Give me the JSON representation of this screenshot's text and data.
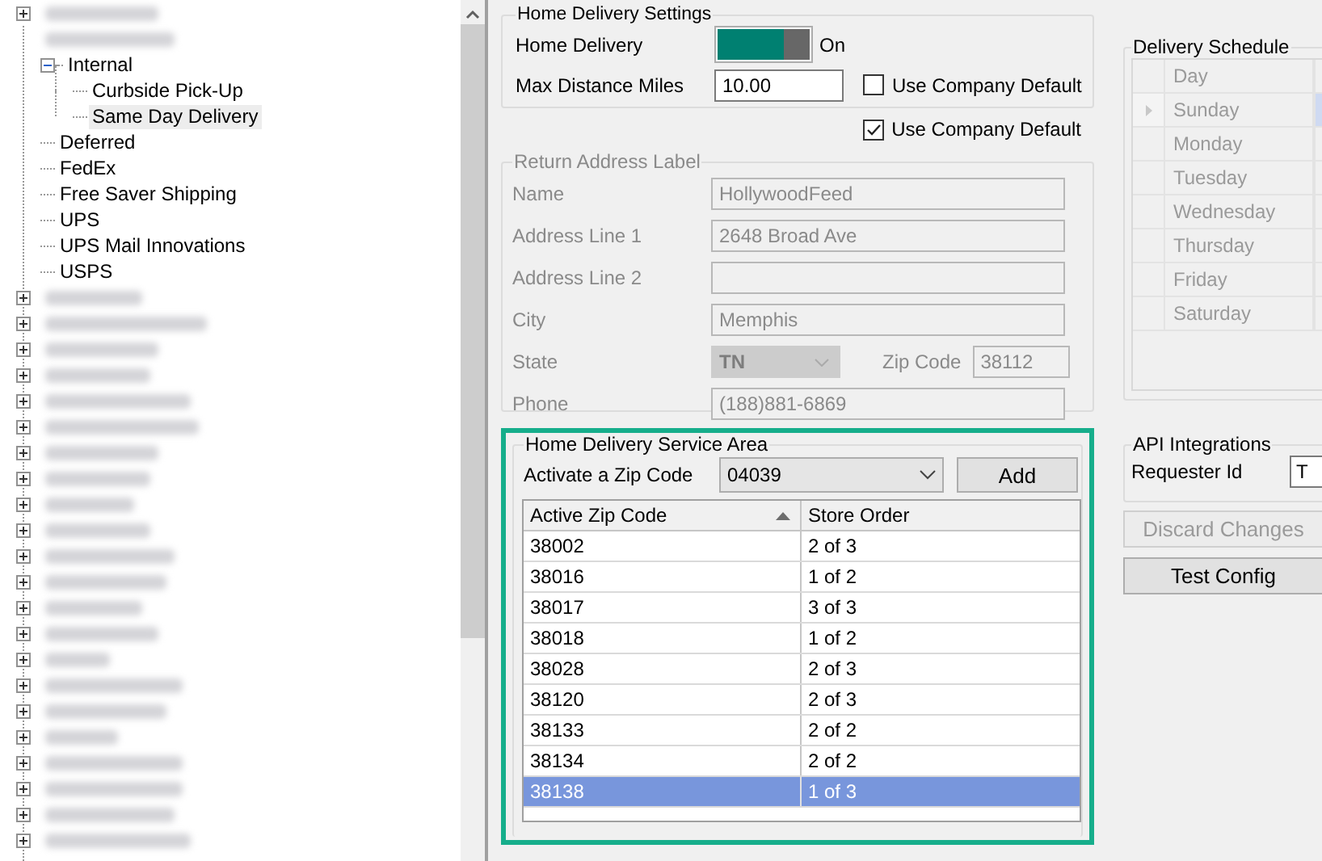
{
  "tree": {
    "items": [
      {
        "label": "Internal",
        "expanded": true,
        "selected": false,
        "children": [
          {
            "label": "Curbside Pick-Up",
            "selected": false
          },
          {
            "label": "Same Day Delivery",
            "selected": true
          }
        ]
      },
      {
        "label": "Deferred",
        "selected": false
      },
      {
        "label": "FedEx",
        "selected": false
      },
      {
        "label": "Free Saver Shipping",
        "selected": false
      },
      {
        "label": "UPS",
        "selected": false
      },
      {
        "label": "UPS Mail Innovations",
        "selected": false
      },
      {
        "label": "USPS",
        "selected": false
      }
    ]
  },
  "home_delivery": {
    "legend": "Home Delivery Settings",
    "toggle_label": "Home Delivery",
    "on": true,
    "state_text": "On",
    "max_distance_label": "Max Distance Miles",
    "max_distance": "10.00",
    "use_default": {
      "label": "Use Company Default",
      "checked": false
    }
  },
  "return_default": {
    "label": "Use Company Default",
    "checked": true
  },
  "return_address": {
    "legend": "Return Address Label",
    "disabled": true,
    "fields": [
      {
        "kind": "text",
        "label": "Name",
        "value": "HollywoodFeed"
      },
      {
        "kind": "text",
        "label": "Address Line 1",
        "value": "2648 Broad Ave"
      },
      {
        "kind": "text",
        "label": "Address Line 2"
      },
      {
        "kind": "text",
        "label": "City",
        "value": "Memphis"
      },
      {
        "kind": "split",
        "label": "State",
        "value": "TN",
        "label2": "Zip Code",
        "value2": "38112"
      },
      {
        "kind": "text",
        "label": "Phone",
        "value": "(188)881-6869"
      }
    ]
  },
  "service_area": {
    "legend": "Home Delivery Service Area",
    "activate_label": "Activate a Zip Code",
    "zip_select": "04039",
    "add_button": "Add",
    "columns": [
      {
        "label": "Active Zip Code",
        "sorted": true
      },
      {
        "label": "Store Order",
        "sorted": false
      }
    ],
    "rows": [
      {
        "cells": [
          "38002",
          "2 of 3"
        ],
        "selected": false
      },
      {
        "cells": [
          "38016",
          "1 of 2"
        ],
        "selected": false
      },
      {
        "cells": [
          "38017",
          "3 of 3"
        ],
        "selected": false
      },
      {
        "cells": [
          "38018",
          "1 of 2"
        ],
        "selected": false
      },
      {
        "cells": [
          "38028",
          "2 of 3"
        ],
        "selected": false
      },
      {
        "cells": [
          "38120",
          "2 of 3"
        ],
        "selected": false
      },
      {
        "cells": [
          "38133",
          "2 of 2"
        ],
        "selected": false
      },
      {
        "cells": [
          "38134",
          "2 of 2"
        ],
        "selected": false
      },
      {
        "cells": [
          "38138",
          "1 of 3"
        ],
        "selected": true
      }
    ]
  },
  "schedule": {
    "legend": "Delivery Schedule",
    "disabled": true,
    "column": "Day",
    "days": [
      {
        "label": "Sunday",
        "selected": true
      },
      {
        "label": "Monday",
        "selected": false
      },
      {
        "label": "Tuesday",
        "selected": false
      },
      {
        "label": "Wednesday",
        "selected": false
      },
      {
        "label": "Thursday",
        "selected": false
      },
      {
        "label": "Friday",
        "selected": false
      },
      {
        "label": "Saturday",
        "selected": false
      }
    ]
  },
  "api": {
    "legend": "API Integrations",
    "label": "Requester Id",
    "value": "T"
  },
  "buttons": [
    {
      "label": "Discard Changes",
      "disabled": true
    },
    {
      "label": "Test Config",
      "disabled": false
    }
  ]
}
